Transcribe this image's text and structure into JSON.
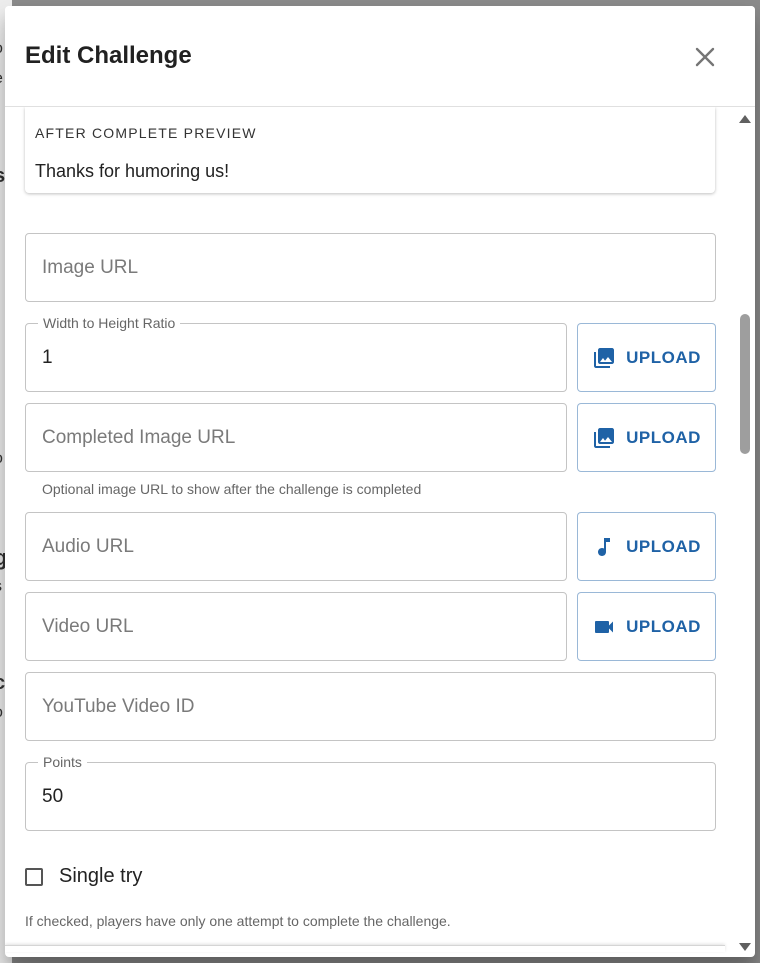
{
  "dialog": {
    "title": "Edit Challenge",
    "close_icon": "close-icon"
  },
  "preview": {
    "heading": "AFTER COMPLETE PREVIEW",
    "text": "Thanks for humoring us!"
  },
  "fields": {
    "image_url": {
      "label": "",
      "value": "",
      "placeholder": "Image URL"
    },
    "ratio": {
      "label": "Width to Height Ratio",
      "value": "1",
      "placeholder": ""
    },
    "completed_image_url": {
      "label": "",
      "value": "",
      "placeholder": "Completed Image URL",
      "helper": "Optional image URL to show after the challenge is completed"
    },
    "audio_url": {
      "label": "",
      "value": "",
      "placeholder": "Audio URL"
    },
    "video_url": {
      "label": "",
      "value": "",
      "placeholder": "Video URL"
    },
    "youtube_id": {
      "label": "",
      "value": "",
      "placeholder": "YouTube Video ID"
    },
    "points": {
      "label": "Points",
      "value": "50",
      "placeholder": ""
    }
  },
  "upload": {
    "label": "UPLOAD",
    "image_icon": "image-icon",
    "audio_icon": "music-note-icon",
    "video_icon": "videocam-icon",
    "color": "#1f62a6"
  },
  "single_try": {
    "label": "Single try",
    "checked": false,
    "helper": "If checked, players have only one attempt to complete the challenge."
  }
}
